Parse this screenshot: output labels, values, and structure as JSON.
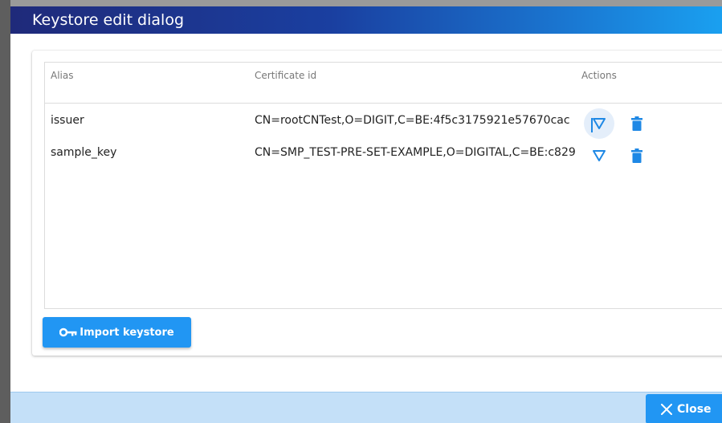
{
  "dialog": {
    "title": "Keystore edit dialog"
  },
  "table": {
    "columns": {
      "alias": "Alias",
      "certificate_id": "Certificate id",
      "actions": "Actions"
    },
    "rows": [
      {
        "alias": "issuer",
        "certificate_id": "CN=rootCNTest,O=DIGIT,C=BE:4f5c3175921e57670cac"
      },
      {
        "alias": "sample_key",
        "certificate_id": "CN=SMP_TEST-PRE-SET-EXAMPLE,O=DIGITAL,C=BE:c829"
      }
    ]
  },
  "buttons": {
    "import_keystore": "Import keystore",
    "close": "Close"
  },
  "icons": {
    "key": "key-icon",
    "edit": "triangle-down-icon",
    "delete": "trash-icon",
    "close": "x-icon"
  },
  "colors": {
    "primary": "#2196f3",
    "header_start": "#1f2a7a",
    "header_end": "#1aa0f0",
    "footer": "#c4e0f8"
  }
}
